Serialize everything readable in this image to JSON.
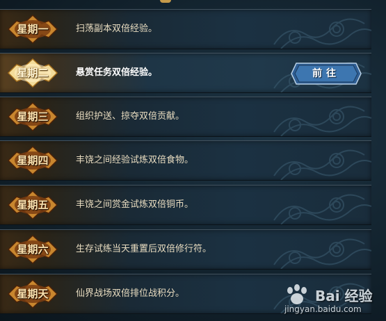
{
  "schedule": [
    {
      "day": "星期一",
      "bonus": "扫荡副本双倍经验。",
      "active": false
    },
    {
      "day": "星期二",
      "bonus": "悬赏任务双倍经验。",
      "active": true
    },
    {
      "day": "星期三",
      "bonus": "组织护送、掠夺双倍贡献。",
      "active": false
    },
    {
      "day": "星期四",
      "bonus": "丰饶之间经验试炼双倍食物。",
      "active": false
    },
    {
      "day": "星期五",
      "bonus": "丰饶之间赏金试炼双倍铜币。",
      "active": false
    },
    {
      "day": "星期六",
      "bonus": "生存试练当天重置后双倍修行符。",
      "active": false
    },
    {
      "day": "星期天",
      "bonus": "仙界战场双倍排位战积分。",
      "active": false
    }
  ],
  "go_button": {
    "label": "前往"
  },
  "watermark": {
    "brand": "Bai 经验",
    "url": "jingyan.baidu.com"
  },
  "colors": {
    "badge_gold": "#c8862e",
    "badge_active": "#f0d48a",
    "button_blue": "#2f5f95",
    "text": "#e8dcc0"
  }
}
